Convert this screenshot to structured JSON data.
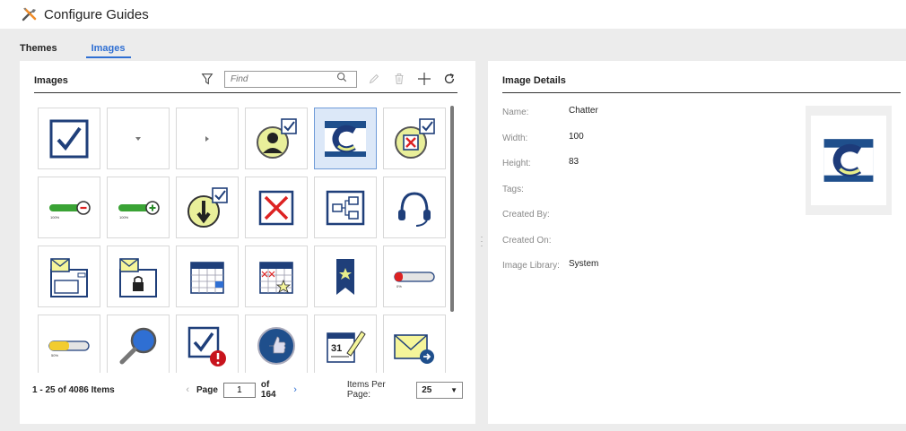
{
  "header": {
    "title": "Configure Guides",
    "icon": "tools-icon"
  },
  "tabs": [
    {
      "label": "Themes",
      "active": false
    },
    {
      "label": "Images",
      "active": true
    }
  ],
  "images_panel": {
    "title": "Images",
    "find_placeholder": "Find",
    "tiles": [
      {
        "icon": "checkbox-checked-icon"
      },
      {
        "icon": "caret-down-icon"
      },
      {
        "icon": "caret-right-icon"
      },
      {
        "icon": "user-check-icon"
      },
      {
        "icon": "chatter-icon",
        "selected": true
      },
      {
        "icon": "x-check-icon"
      },
      {
        "icon": "progress-minus-icon",
        "label": "100%"
      },
      {
        "icon": "progress-plus-icon",
        "label": "100%"
      },
      {
        "icon": "download-check-icon"
      },
      {
        "icon": "close-box-icon"
      },
      {
        "icon": "workflow-icon"
      },
      {
        "icon": "headset-icon"
      },
      {
        "icon": "mail-form-icon"
      },
      {
        "icon": "mail-lock-icon"
      },
      {
        "icon": "calendar-grid-icon"
      },
      {
        "icon": "calendar-star-icon"
      },
      {
        "icon": "bookmark-star-icon"
      },
      {
        "icon": "progress-red-icon",
        "label": "0%"
      },
      {
        "icon": "progress-half-icon",
        "label": "50%"
      },
      {
        "icon": "magnifier-icon"
      },
      {
        "icon": "checkbox-alert-icon"
      },
      {
        "icon": "thumbs-up-icon"
      },
      {
        "icon": "calendar-sign-icon",
        "label": "31"
      },
      {
        "icon": "mail-arrow-icon"
      }
    ],
    "footer": {
      "count_text": "1 - 25 of 4086 Items",
      "page_label": "Page",
      "page_value": "1",
      "of_text": "of 164",
      "per_page_label": "Items Per Page:",
      "per_page_value": "25"
    }
  },
  "details_panel": {
    "title": "Image Details",
    "fields": [
      {
        "key": "Name:",
        "value": "Chatter"
      },
      {
        "key": "Width:",
        "value": "100"
      },
      {
        "key": "Height:",
        "value": "83"
      },
      {
        "key": "Tags:",
        "value": ""
      },
      {
        "key": "Created By:",
        "value": ""
      },
      {
        "key": "Created On:",
        "value": ""
      },
      {
        "key": "Image Library:",
        "value": "System"
      }
    ]
  },
  "colors": {
    "accent": "#2f6fd3",
    "icon_navy": "#1f3f7a",
    "icon_green": "#3aa335"
  }
}
